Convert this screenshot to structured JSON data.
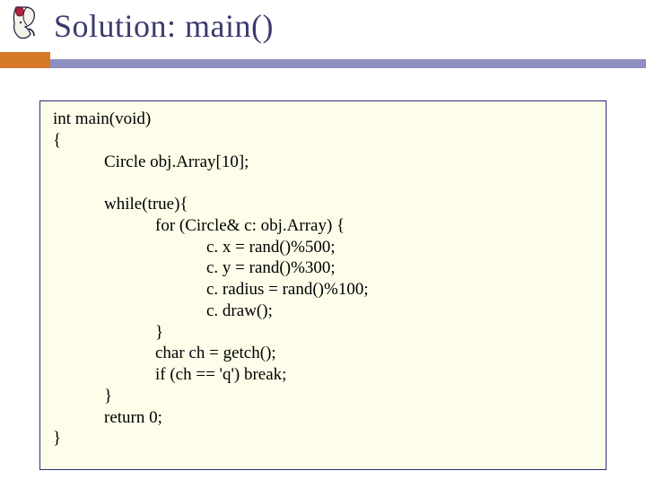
{
  "title": "Solution: main()",
  "code": "int main(void)\n{\n            Circle obj.Array[10];\n\n            while(true){\n                        for (Circle& c: obj.Array) {\n                                    c. x = rand()%500;\n                                    c. y = rand()%300;\n                                    c. radius = rand()%100;\n                                    c. draw();\n                        }\n                        char ch = getch();\n                        if (ch == 'q') break;\n            }\n            return 0;\n}"
}
